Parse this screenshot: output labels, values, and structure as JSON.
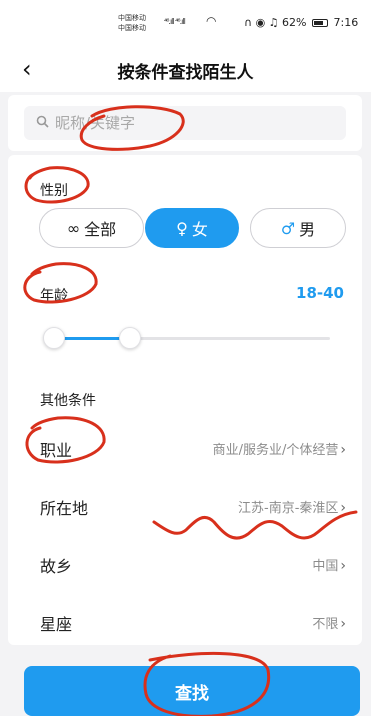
{
  "status_bar": {
    "carrier_1": "中国移动",
    "carrier_2": "中国移动",
    "signal_1": "⁴⁶.ıll",
    "signal_2": "⁴⁶.ıll",
    "battery_percent": "62%",
    "time": "7:16"
  },
  "nav": {
    "back_symbol": "‹",
    "title": "按条件查找陌生人"
  },
  "search": {
    "placeholder": "昵称/关键字"
  },
  "gender": {
    "label": "性别",
    "options": [
      {
        "label": "全部",
        "icon": "infinity-icon",
        "glyph": "∞"
      },
      {
        "label": "女",
        "icon": "female-icon",
        "glyph": "♀"
      },
      {
        "label": "男",
        "icon": "male-icon",
        "glyph": "♂"
      }
    ],
    "selected": "女"
  },
  "age": {
    "label": "年龄",
    "value": "18-40"
  },
  "other": {
    "label": "其他条件",
    "rows": [
      {
        "name": "职业",
        "value": "商业/服务业/个体经营"
      },
      {
        "name": "所在地",
        "value": "江苏-南京-秦淮区"
      },
      {
        "name": "故乡",
        "value": "中国"
      },
      {
        "name": "星座",
        "value": "不限"
      }
    ]
  },
  "submit": {
    "label": "查找"
  },
  "colors": {
    "accent": "#1f9bef",
    "annotation": "#d8301c"
  }
}
